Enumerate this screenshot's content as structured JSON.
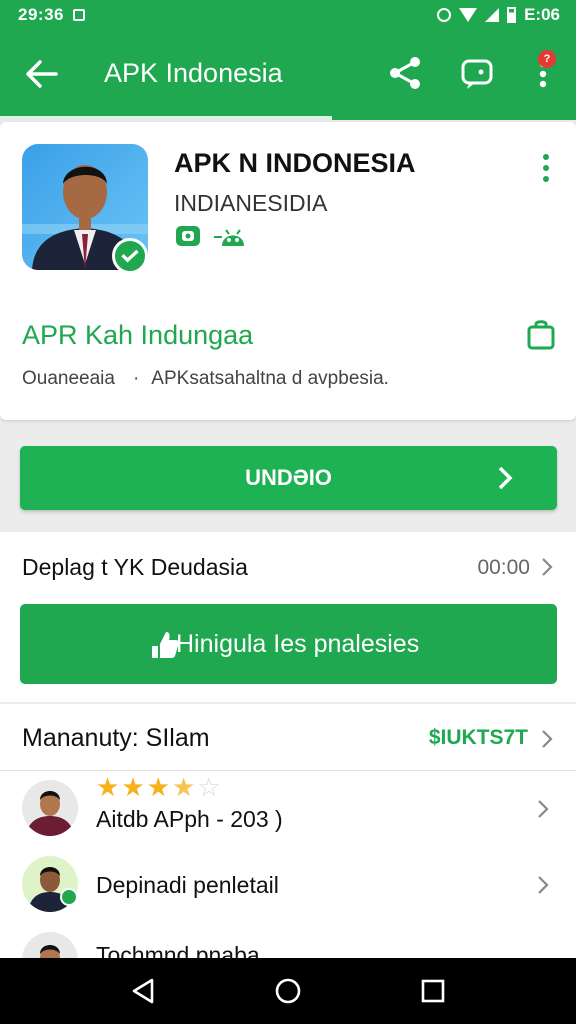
{
  "status_bar": {
    "time": "29:36",
    "clock_right": "E:06",
    "icons": [
      "alarm-icon",
      "wifi-icon",
      "signal-icon",
      "battery-icon"
    ]
  },
  "toolbar": {
    "title": "APK Indonesia",
    "back_icon": "arrow-left-icon",
    "share_icon": "share-icon",
    "chat_icon": "chat-icon",
    "more_icon": "more-vert-icon",
    "badge": "?"
  },
  "app_card": {
    "name": "APK N INDONESIA",
    "developer": "INDIANESIDIA",
    "subtitle": "APR Kah Indungaa",
    "meta_left": "Ouaneeaia",
    "meta_separator": "·",
    "meta_right": "APKsatsahaltna d avpbesia."
  },
  "primary_button": {
    "label": "UNDƏIO"
  },
  "details": {
    "row_label": "Deplag t  YK Deudasia",
    "row_value": "00:00",
    "secondary_button_label": "Hinigula Ies pnalesies"
  },
  "section": {
    "title": "Mananuty: SIlam",
    "value": "$IUKTS7T"
  },
  "list": [
    {
      "label": "Aitdb APph - 203 )",
      "rating": 3.5,
      "stars_total": 5
    },
    {
      "label": "Depinadi penletail"
    },
    {
      "label": "Tochmnd pnaba"
    }
  ],
  "colors": {
    "primary": "#1fa84f",
    "button": "#1fb254",
    "star": "#f6b21b"
  },
  "nav_bar": {
    "icons": [
      "nav-back-icon",
      "nav-home-icon",
      "nav-recents-icon"
    ]
  }
}
